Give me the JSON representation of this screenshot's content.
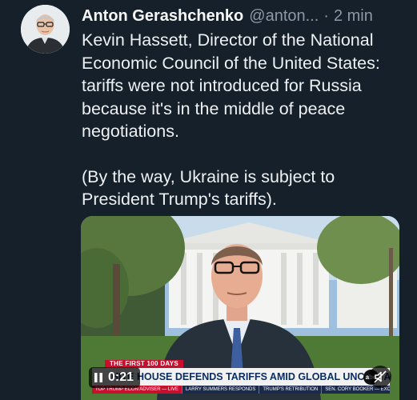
{
  "tweet": {
    "author_name": "Anton Gerashchenko",
    "handle": "@anton...",
    "separator": "·",
    "time": "2 min",
    "paragraphs": [
      "Kevin Hassett, Director of the National Economic Council of the United States: tariffs were not introduced for Russia because it's in the middle of peace negotiations.",
      "(By the way, Ukraine is subject to President Trump's tariffs)."
    ]
  },
  "media": {
    "video_time": "0:21",
    "mute_icon": "speaker-muted-icon",
    "play_icon": "pause-icon",
    "lower_third": {
      "top_tag": "THE FIRST 100 DAYS",
      "headline": "HITE HOUSE DEFENDS TARIFFS AMID GLOBAL UNCERTAINTY",
      "network_logo": "abc",
      "ticker": [
        "TOP TRUMP ECON ADVISER — LIVE",
        "LARRY SUMMERS RESPONDS",
        "TRUMP'S RETRIBUTION",
        "SEN. CORY BOOKER — EXCLUSIVE"
      ]
    }
  },
  "colors": {
    "background": "#15202b",
    "text": "#e7e9ea",
    "muted": "#8b98a5",
    "news_red": "#c8102e",
    "news_navy": "#0b2d63"
  }
}
